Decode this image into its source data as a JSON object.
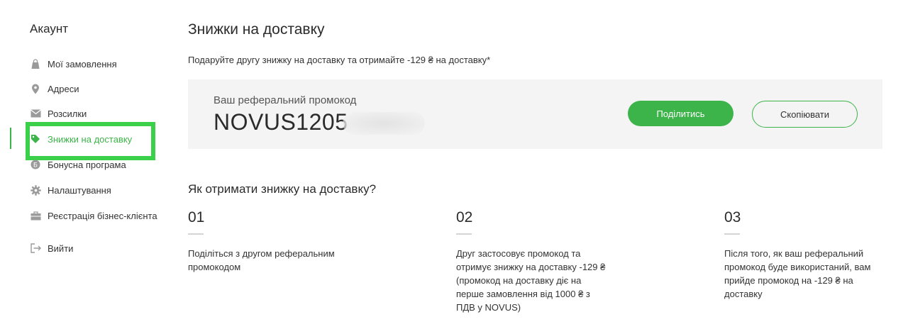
{
  "sidebar": {
    "title": "Акаунт",
    "items": [
      {
        "label": "Мої замовлення",
        "icon": "bag-icon"
      },
      {
        "label": "Адреси",
        "icon": "location-pin-icon"
      },
      {
        "label": "Розсилки",
        "icon": "envelope-icon"
      },
      {
        "label": "Знижки на доставку",
        "icon": "tag-icon",
        "active": true
      },
      {
        "label": "Бонусна програма",
        "icon": "bonus-coin-icon"
      },
      {
        "label": "Налаштування",
        "icon": "gear-icon"
      },
      {
        "label": "Реєстрація бізнес-клієнта",
        "icon": "briefcase-icon"
      },
      {
        "label": "Вийти",
        "icon": "logout-icon"
      }
    ]
  },
  "main": {
    "title": "Знижки на доставку",
    "subtitle": "Подаруйте другу знижку на доставку та отримайте -129 ₴ на доставку*",
    "promo": {
      "label": "Ваш реферальний промокод",
      "code": "NOVUS1205",
      "share_label": "Поділитись",
      "copy_label": "Скопіювати"
    },
    "how_title": "Як отримати знижку на доставку?",
    "steps": [
      {
        "number": "01",
        "text": "Поділіться з другом реферальним промокодом"
      },
      {
        "number": "02",
        "text": "Друг застосовує промокод та отримує знижку на доставку -129 ₴ (промокод на доставку діє на перше замовлення від 1000 ₴ з ПДВ у NOVUS)"
      },
      {
        "number": "03",
        "text": "Після того, як ваш реферальний промокод буде використаний, вам прийде промокод на -129 ₴ на доставку"
      }
    ]
  },
  "colors": {
    "accent": "#3db44a",
    "highlight": "#3bd04a",
    "promo_bg": "#f4f4f4"
  }
}
